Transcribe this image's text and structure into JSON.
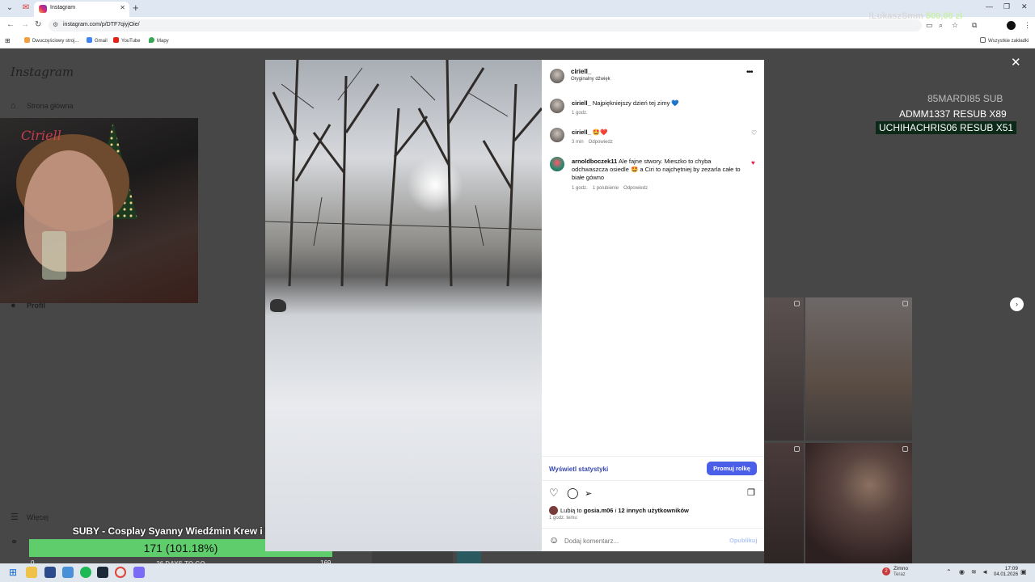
{
  "browser": {
    "tab_title": "Instagram",
    "url": "instagram.com/p/DTF7qiyjOie/",
    "bookmarks": [
      "Dwuczęściowy stroj...",
      "Gmail",
      "YouTube",
      "Mapy"
    ],
    "all_bookmarks": "Wszystkie zakładki"
  },
  "overlay": {
    "donation_user": "!LukaszSmm",
    "donation_amount": "500,00 zł",
    "subs": [
      "85MARDI85  SUB",
      "ADMM1337  RESUB X89",
      "UCHIHACHRIS06  RESUB X51"
    ],
    "goal_title": "SUBY - Cosplay Syanny Wiedźmin Krew i Wino",
    "goal_value": "171 (101.18%)",
    "goal_progress": 1.0,
    "goal_days": "26 DAYS TO GO",
    "goal_min": "0",
    "goal_max": "169"
  },
  "sidebar": {
    "logo": "Instagram",
    "home": "Strona główna",
    "profile": "Profil",
    "more": "Więcej"
  },
  "post": {
    "author": "ciriell_",
    "audio": "Oryginalny dźwięk",
    "comments": [
      {
        "user": "ciriell_",
        "text": "Najpiękniejszy dzień tej zimy 💙",
        "time": "1 godz.",
        "likes": "",
        "reply": ""
      },
      {
        "user": "ciriell_",
        "text": "🤩❤️",
        "time": "3 min",
        "likes": "",
        "reply": "Odpowiedz"
      },
      {
        "user": "arnoldboczek11",
        "text": "Ale fajne stwory. Mieszko to chyba odchwaszcza osiedle 🤩 a Ciri to najchętniej by zezarla całe to białe gówno",
        "time": "1 godz.",
        "likes": "1 polubienie",
        "reply": "Odpowiedz"
      }
    ],
    "stats_link": "Wyświetl statystyki",
    "promote": "Promuj rolkę",
    "likes_prefix": "Lubią to",
    "likes_user": "gosia.m06",
    "likes_suffix": "i",
    "likes_others": "12 innych użytkowników",
    "posted_ago": "1 godz. temu",
    "comment_placeholder": "Dodaj komentarz...",
    "publish": "Opublikuj"
  },
  "taskbar": {
    "weather_temp": "Zimno",
    "weather_sub": "Teraz",
    "weather_badge": "2",
    "time": "17:09",
    "date": "04.01.2026"
  },
  "colors": {
    "accent": "#4a5ee8",
    "goal_bar": "#5fcd6b",
    "heart": "#ed1c45"
  }
}
